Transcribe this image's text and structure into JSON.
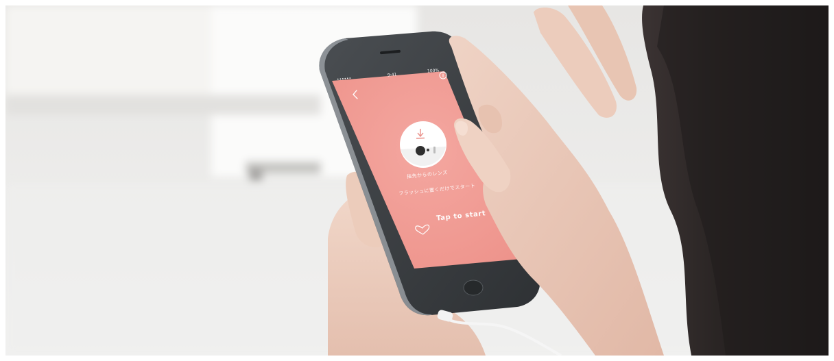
{
  "phone": {
    "screen_color": "#f09b94",
    "status_bar": {
      "carrier": "•••••• ",
      "time": "9:41",
      "battery": "100%"
    },
    "instruction_line_1": "指先からのレンズ",
    "instruction_line_2": "フラッシュに置くだけでスタート",
    "tap_label": "Tap to start"
  },
  "icons": {
    "back": "chevron-left-icon",
    "info": "info-icon",
    "download": "download-arrow-icon",
    "device": "lens-device-icon",
    "heart": "heart-icon"
  }
}
